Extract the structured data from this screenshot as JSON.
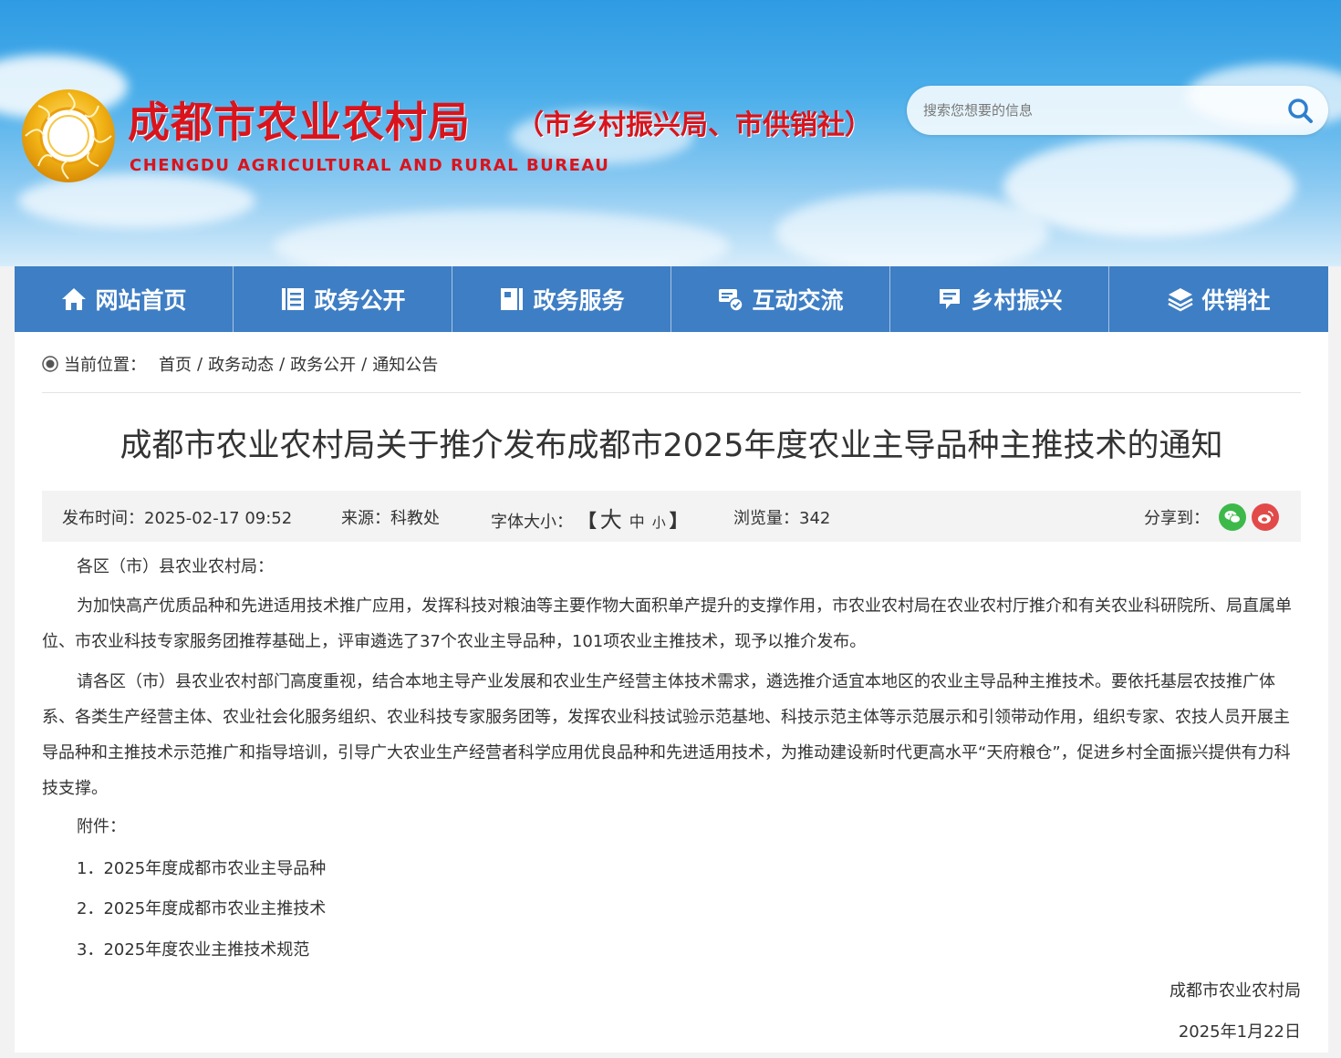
{
  "header": {
    "title": "成都市农业农村局",
    "subtitle": "（市乡村振兴局、市供销社）",
    "english_name": "CHENGDU AGRICULTURAL AND RURAL BUREAU",
    "search_placeholder": "搜索您想要的信息",
    "logo_icon": "emblem-icon",
    "search_icon": "search-icon"
  },
  "nav": {
    "items": [
      {
        "label": "网站首页",
        "icon": "home-icon"
      },
      {
        "label": "政务公开",
        "icon": "list-icon"
      },
      {
        "label": "政务服务",
        "icon": "book-icon"
      },
      {
        "label": "互动交流",
        "icon": "chat-icon"
      },
      {
        "label": "乡村振兴",
        "icon": "message-icon"
      },
      {
        "label": "供销社",
        "icon": "layers-icon"
      }
    ]
  },
  "breadcrumb": {
    "prefix": "当前位置：",
    "items": [
      "首页",
      "政务动态",
      "政务公开",
      "通知公告"
    ],
    "separator": "/"
  },
  "article": {
    "title": "成都市农业农村局关于推介发布成都市2025年度农业主导品种主推技术的通知",
    "meta": {
      "publish_time": "发布时间：2025-02-17 09:52",
      "source": "来源：科教处",
      "font_size_label": "字体大小：",
      "font_large": "大",
      "font_medium": "中",
      "font_small": "小",
      "bracket_open": "【",
      "bracket_close": "】",
      "views": "浏览量：342",
      "share_label": "分享到："
    },
    "greeting": "各区（市）县农业农村局：",
    "paragraphs": [
      "为加快高产优质品种和先进适用技术推广应用，发挥科技对粮油等主要作物大面积单产提升的支撑作用，市农业农村局在农业农村厅推介和有关农业科研院所、局直属单位、市农业科技专家服务团推荐基础上，评审遴选了37个农业主导品种，101项农业主推技术，现予以推介发布。",
      "请各区（市）县农业农村部门高度重视，结合本地主导产业发展和农业生产经营主体技术需求，遴选推介适宜本地区的农业主导品种主推技术。要依托基层农技推广体系、各类生产经营主体、农业社会化服务组织、农业科技专家服务团等，发挥农业科技试验示范基地、科技示范主体等示范展示和引领带动作用，组织专家、农技人员开展主导品种和主推技术示范推广和指导培训，引导广大农业生产经营者科学应用优良品种和先进适用技术，为推动建设新时代更高水平“天府粮仓”，促进乡村全面振兴提供有力科技支撑。"
    ],
    "attachments_label": "附件：",
    "attachments": [
      "1．2025年度成都市农业主导品种",
      "2．2025年度成都市农业主推技术",
      "3．2025年度农业主推技术规范"
    ],
    "signature_org": "成都市农业农村局",
    "signature_date": "2025年1月22日"
  },
  "colors": {
    "nav_bg": "#3e7ec4",
    "title_red": "#d9141c",
    "wechat": "#3db94a",
    "weibo": "#e24a4a"
  }
}
